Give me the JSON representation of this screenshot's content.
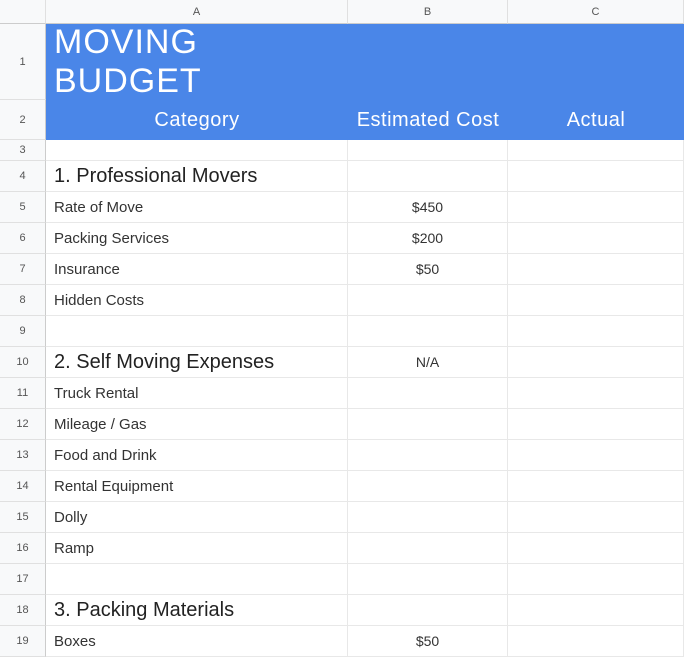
{
  "columns": {
    "A": "A",
    "B": "B",
    "C": "C"
  },
  "title": "MOVING BUDGET",
  "headers": {
    "category": "Category",
    "estimated": "Estimated Cost",
    "actual": "Actual"
  },
  "rows": [
    {
      "num": "1"
    },
    {
      "num": "2"
    },
    {
      "num": "3",
      "a": "",
      "b": "",
      "c": ""
    },
    {
      "num": "4",
      "a": "1. Professional Movers",
      "b": "",
      "c": "",
      "section": true
    },
    {
      "num": "5",
      "a": "Rate of Move",
      "b": "$450",
      "c": ""
    },
    {
      "num": "6",
      "a": "Packing Services",
      "b": "$200",
      "c": ""
    },
    {
      "num": "7",
      "a": "Insurance",
      "b": "$50",
      "c": ""
    },
    {
      "num": "8",
      "a": "Hidden Costs",
      "b": "",
      "c": ""
    },
    {
      "num": "9",
      "a": "",
      "b": "",
      "c": ""
    },
    {
      "num": "10",
      "a": "2. Self Moving Expenses",
      "b": "N/A",
      "c": "",
      "section": true
    },
    {
      "num": "11",
      "a": "Truck Rental",
      "b": "",
      "c": ""
    },
    {
      "num": "12",
      "a": "Mileage / Gas",
      "b": "",
      "c": ""
    },
    {
      "num": "13",
      "a": "Food and Drink",
      "b": "",
      "c": ""
    },
    {
      "num": "14",
      "a": "Rental Equipment",
      "b": "",
      "c": ""
    },
    {
      "num": "15",
      "a": "Dolly",
      "b": "",
      "c": ""
    },
    {
      "num": "16",
      "a": "Ramp",
      "b": "",
      "c": ""
    },
    {
      "num": "17",
      "a": "",
      "b": "",
      "c": ""
    },
    {
      "num": "18",
      "a": "3. Packing Materials",
      "b": "",
      "c": "",
      "section": true
    },
    {
      "num": "19",
      "a": "Boxes",
      "b": "$50",
      "c": ""
    }
  ]
}
